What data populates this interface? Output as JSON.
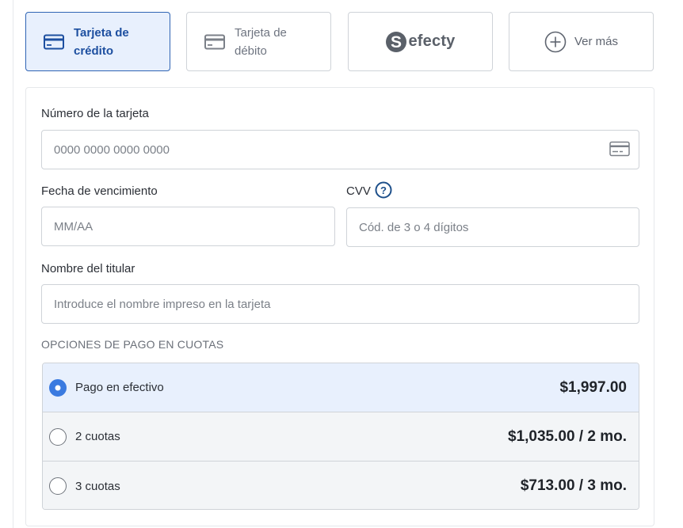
{
  "payment_methods": {
    "items": [
      {
        "label": "Tarjeta de crédito",
        "icon": "credit-card-icon",
        "active": true
      },
      {
        "label": "Tarjeta de débito",
        "icon": "debit-card-icon",
        "active": false
      },
      {
        "label": "efecty",
        "icon": "efecty-logo",
        "active": false
      },
      {
        "label": "Ver más",
        "icon": "plus-circle-icon",
        "active": false
      }
    ]
  },
  "form": {
    "card_number": {
      "label": "Número de la tarjeta",
      "placeholder": "0000 0000 0000 0000",
      "value": ""
    },
    "expiry": {
      "label": "Fecha de vencimiento",
      "placeholder": "MM/AA",
      "value": ""
    },
    "cvv": {
      "label": "CVV",
      "placeholder": "Cód. de 3 o 4 dígitos",
      "value": "",
      "help_icon": "question-circle-icon"
    },
    "holder": {
      "label": "Nombre del titular",
      "placeholder": "Introduce el nombre impreso en la tarjeta",
      "value": ""
    }
  },
  "installments": {
    "title": "OPCIONES DE PAGO EN CUOTAS",
    "options": [
      {
        "label": "Pago en efectivo",
        "price": "$1,997.00",
        "selected": true
      },
      {
        "label": "2 cuotas",
        "price": "$1,035.00 / 2 mo.",
        "selected": false
      },
      {
        "label": "3 cuotas",
        "price": "$713.00 / 3 mo.",
        "selected": false
      }
    ]
  },
  "colors": {
    "accent": "#2f64b4",
    "active_bg": "#e8f0fd",
    "radio_selected": "#3a7ae0",
    "border": "#cfd3d8"
  }
}
